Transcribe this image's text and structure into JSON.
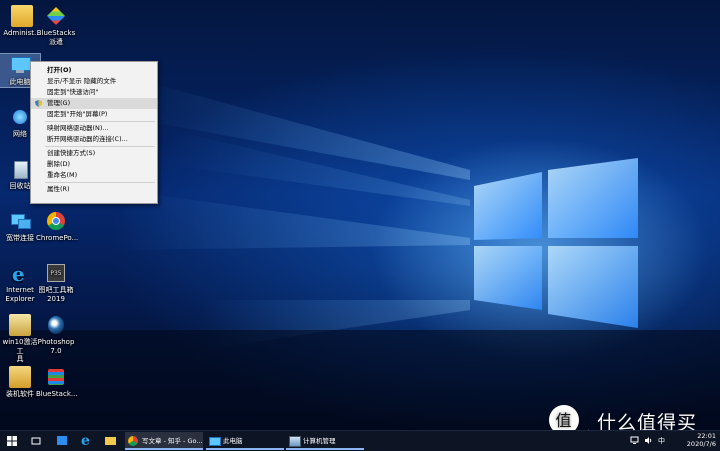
{
  "desktop_icons": {
    "admin": "Administ...",
    "bluestacks_multi_line1": "BlueStacks",
    "bluestacks_multi_line2": "派遣",
    "this_pc": "此电脑",
    "network": "网络",
    "recycle_bin": "回收站",
    "broadband": "宽带连接",
    "chrome": "ChromePo...",
    "ie_line1": "Internet",
    "ie_line2": "Explorer",
    "ps_tool_badge": "P35",
    "ps_tool_line1": "图吧工具箱",
    "ps_tool_line2": "2019",
    "win10_tool_line1": "win10激活工",
    "win10_tool_line2": "具",
    "photoshop_line1": "Photoshop",
    "photoshop_line2": "7.0",
    "install_software": "装机软件",
    "bluestacks2": "BlueStack..."
  },
  "context_menu": {
    "items": [
      {
        "label": "打开(O)"
      },
      {
        "label": "显示/不显示 隐藏的文件"
      },
      {
        "label": "固定到\"快速访问\""
      },
      {
        "label": "管理(G)"
      },
      {
        "label": "固定到\"开始\"屏幕(P)"
      },
      {
        "label": "映射网络驱动器(N)..."
      },
      {
        "label": "断开网络驱动器的连接(C)..."
      },
      {
        "label": "创建快捷方式(S)"
      },
      {
        "label": "删除(D)"
      },
      {
        "label": "重命名(M)"
      },
      {
        "label": "属性(R)"
      }
    ]
  },
  "taskbar": {
    "apps": [
      {
        "label": "写文章 - 知乎 - Go..."
      },
      {
        "label": "此电脑"
      },
      {
        "label": "计算机管理"
      }
    ],
    "time": "22:01",
    "date": "2020/7/6"
  },
  "watermark": {
    "text": "值 什么值得买"
  },
  "colors": {
    "menu_bg": "#f2f2f2",
    "menu_hover": "#dadada",
    "taskbar_bg": "#0d1424",
    "accent": "#8ab4f8"
  }
}
